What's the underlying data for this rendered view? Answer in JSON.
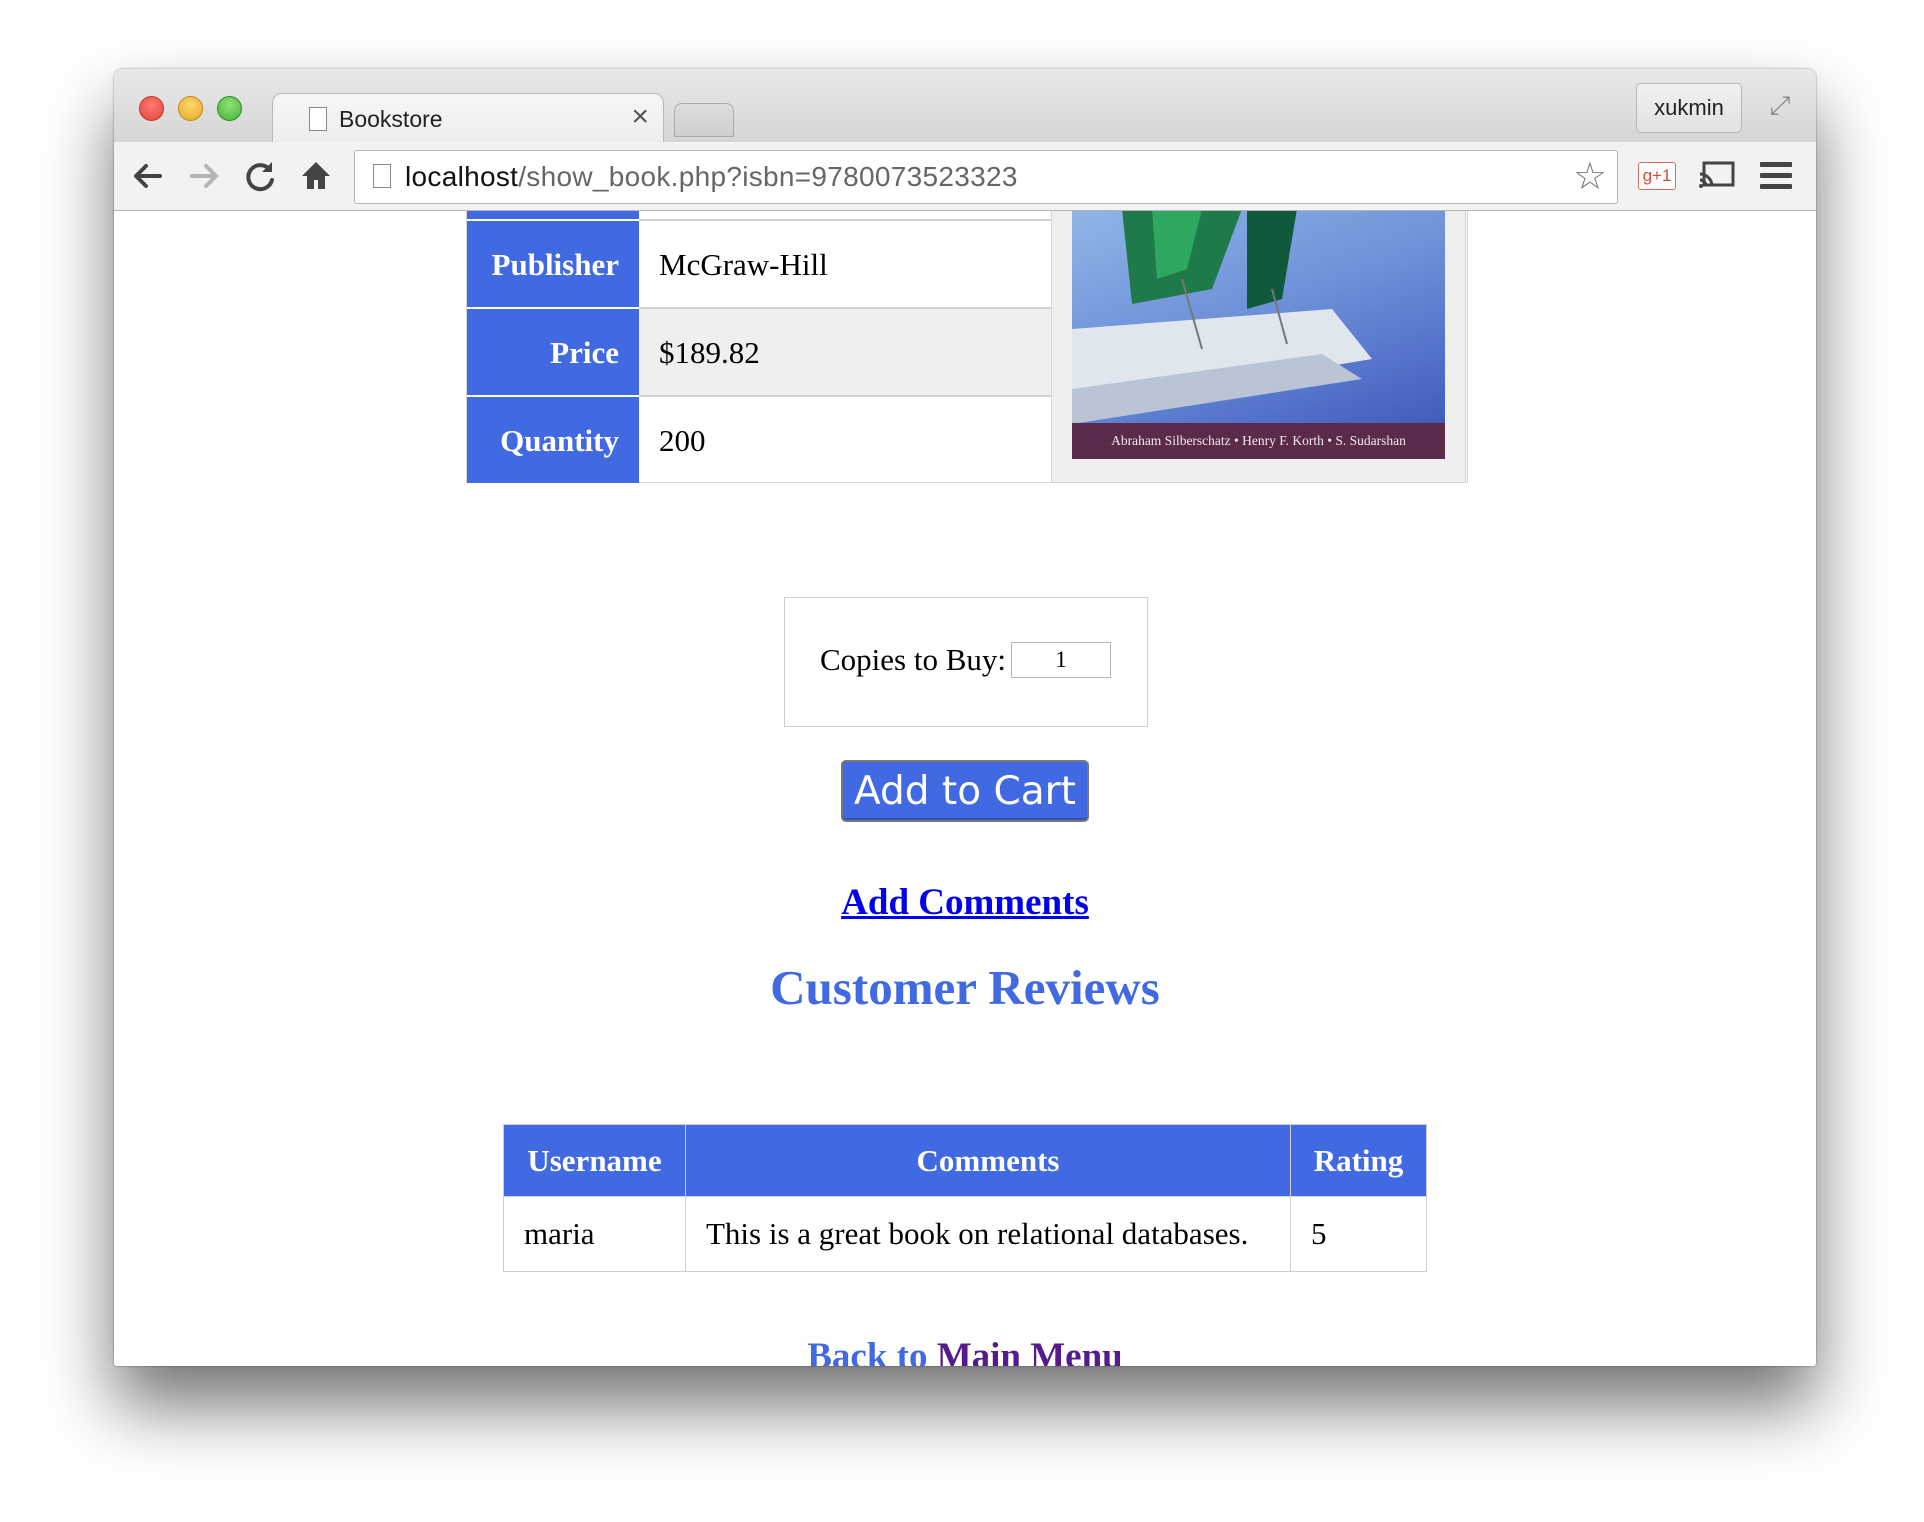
{
  "browser": {
    "tab_title": "Bookstore",
    "tab_close": "×",
    "profile_name": "xukmin",
    "url_host": "localhost",
    "url_path": "/show_book.php?isbn=9780073523323",
    "gplus_label": "g+1",
    "icons": {
      "back": "arrow-left",
      "forward": "arrow-right",
      "reload": "reload",
      "home": "home",
      "star": "star",
      "cast": "cast",
      "menu": "hamburger"
    }
  },
  "book": {
    "rows": [
      {
        "label": "Publisher",
        "value": "McGraw-Hill"
      },
      {
        "label": "Price",
        "value": "$189.82"
      },
      {
        "label": "Quantity",
        "value": "200"
      }
    ],
    "cover_authors": "Abraham Silberschatz • Henry F. Korth • S. Sudarshan"
  },
  "purchase": {
    "copies_label": "Copies to Buy:",
    "copies_value": "1",
    "add_to_cart_label": "Add to Cart"
  },
  "add_comments_label": "Add Comments",
  "reviews": {
    "heading": "Customer Reviews",
    "columns": [
      "Username",
      "Comments",
      "Rating"
    ],
    "rows": [
      {
        "username": "maria",
        "comment": "This is a great book on relational databases.",
        "rating": "5"
      }
    ]
  },
  "footer": {
    "back_prefix": "Back to",
    "main_menu_label": "Main Menu"
  },
  "colors": {
    "accent": "#4169e1",
    "link": "#0000ee",
    "visited_link": "#551a8b"
  }
}
